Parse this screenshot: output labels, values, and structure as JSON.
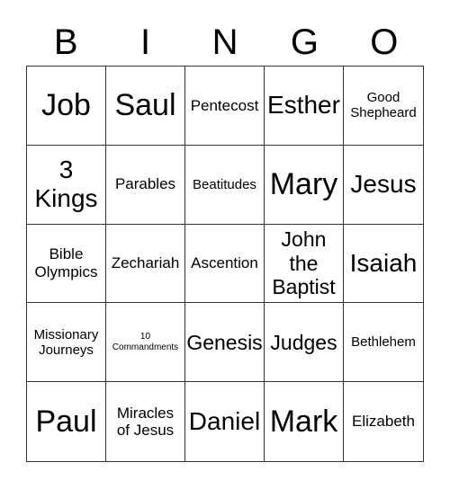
{
  "header": {
    "letters": [
      "B",
      "I",
      "N",
      "G",
      "O"
    ]
  },
  "cells": [
    {
      "text": "Job",
      "size": "xl"
    },
    {
      "text": "Saul",
      "size": "xl"
    },
    {
      "text": "Pentecost",
      "size": "s"
    },
    {
      "text": "Esther",
      "size": "l"
    },
    {
      "text": "Good\nShepheard",
      "size": "xs"
    },
    {
      "text": "3\nKings",
      "size": "l"
    },
    {
      "text": "Parables",
      "size": "s"
    },
    {
      "text": "Beatitudes",
      "size": "xs"
    },
    {
      "text": "Mary",
      "size": "xl"
    },
    {
      "text": "Jesus",
      "size": "l"
    },
    {
      "text": "Bible\nOlympics",
      "size": "s"
    },
    {
      "text": "Zechariah",
      "size": "s"
    },
    {
      "text": "Ascention",
      "size": "s"
    },
    {
      "text": "John\nthe\nBaptist",
      "size": "m"
    },
    {
      "text": "Isaiah",
      "size": "l"
    },
    {
      "text": "Missionary\nJourneys",
      "size": "xs"
    },
    {
      "text": "10\nCommandments",
      "size": "tiny"
    },
    {
      "text": "Genesis",
      "size": "m"
    },
    {
      "text": "Judges",
      "size": "m"
    },
    {
      "text": "Bethlehem",
      "size": "xs"
    },
    {
      "text": "Paul",
      "size": "xl"
    },
    {
      "text": "Miracles\nof Jesus",
      "size": "s"
    },
    {
      "text": "Daniel",
      "size": "l"
    },
    {
      "text": "Mark",
      "size": "xl"
    },
    {
      "text": "Elizabeth",
      "size": "s"
    }
  ]
}
